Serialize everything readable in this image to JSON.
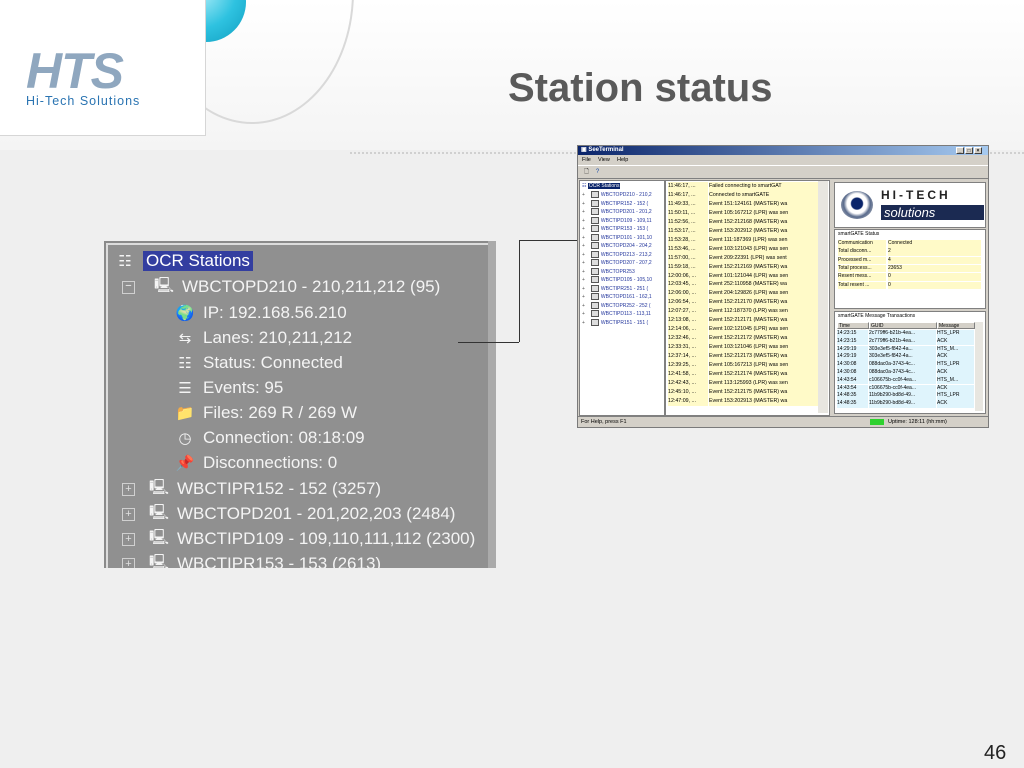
{
  "slide": {
    "title": "Station status",
    "number": "46"
  },
  "logo": {
    "mark": "HTS",
    "subtitle": "Hi-Tech Solutions"
  },
  "zoom_tree": {
    "root": "OCR Stations",
    "expanded_station": "WBCTOPD210 - 210,211,212  (95)",
    "details": [
      {
        "icon": "globe-icon",
        "text": "IP: 192.168.56.210"
      },
      {
        "icon": "lanes-icon",
        "text": "Lanes: 210,211,212"
      },
      {
        "icon": "network-status-icon",
        "text": "Status: Connected"
      },
      {
        "icon": "events-icon",
        "text": "Events: 95"
      },
      {
        "icon": "folder-icon",
        "text": "Files: 269 R / 269 W"
      },
      {
        "icon": "clock-icon",
        "text": "Connection: 08:18:09"
      },
      {
        "icon": "pushpin-icon",
        "text": "Disconnections: 0"
      }
    ],
    "other_stations": [
      "WBCTIPR152 - 152  (3257)",
      "WBCTOPD201 - 201,202,203  (2484)",
      "WBCTIPD109 - 109,110,111,112  (2300)",
      "WBCTIPR153 - 153  (2613)"
    ]
  },
  "app": {
    "title": "SeeTerminal",
    "menu": [
      "File",
      "View",
      "Help"
    ],
    "tree_root": "OCR Stations",
    "tree_items": [
      "WBCTOPD210 - 210,2",
      "WBCTIPR152 - 152  (",
      "WBCTOPD201 - 201,2",
      "WBCTIPD109 - 109,11",
      "WBCTIPR153 - 153  (",
      "WBCTIPD101 - 101,10",
      "WBCTOPD204 - 204,2",
      "WBCTOPD213 - 213,2",
      "WBCTOPD207 - 207,2",
      "WBCTOPR253",
      "WBCTIPD105 - 105,10",
      "WBCTIPR251 - 251  (",
      "WBCTOPD161 - 162,1",
      "WBCTOPR252 - 252  (",
      "WBCTIPD113 - 113,11",
      "WBCTIPR151 - 151  ("
    ],
    "log": [
      [
        "11:46:17, ...",
        "Failed connecting to smartGAT"
      ],
      [
        "11:46:17, ...",
        "Connected to smartGATE"
      ],
      [
        "11:49:33, ...",
        "Event 151:124161 (MASTER) wa"
      ],
      [
        "11:50:11, ...",
        "Event 105:167212 (LPR) was sen"
      ],
      [
        "11:52:56, ...",
        "Event 152:212168 (MASTER) wa"
      ],
      [
        "11:53:17, ...",
        "Event 153:202912 (MASTER) wa"
      ],
      [
        "11:53:28, ...",
        "Event 111:187369 (LPR) was sen"
      ],
      [
        "11:53:46, ...",
        "Event 103:121043 (LPR) was sen"
      ],
      [
        "11:57:00, ...",
        "Event 209:22391 (LPR) was sent"
      ],
      [
        "11:59:18, ...",
        "Event 152:212169 (MASTER) wa"
      ],
      [
        "12:00:06, ...",
        "Event 101:121044 (LPR) was sen"
      ],
      [
        "12:03:45, ...",
        "Event 252:110958 (MASTER) wa"
      ],
      [
        "12:06:00, ...",
        "Event 204:129826 (LPR) was sen"
      ],
      [
        "12:06:54, ...",
        "Event 152:212170 (MASTER) wa"
      ],
      [
        "12:07:27, ...",
        "Event 112:187370 (LPR) was sen"
      ],
      [
        "12:13:08, ...",
        "Event 152:212171 (MASTER) wa"
      ],
      [
        "12:14:06, ...",
        "Event 102:121045 (LPR) was sen"
      ],
      [
        "12:32:46, ...",
        "Event 152:212172 (MASTER) wa"
      ],
      [
        "12:33:31, ...",
        "Event 103:121046 (LPR) was sen"
      ],
      [
        "12:37:14, ...",
        "Event 152:212173 (MASTER) wa"
      ],
      [
        "12:39:25, ...",
        "Event 105:167213 (LPR) was sen"
      ],
      [
        "12:41:58, ...",
        "Event 152:212174 (MASTER) wa"
      ],
      [
        "12:42:43, ...",
        "Event 113:125993 (LPR) was sen"
      ],
      [
        "12:45:10, ...",
        "Event 152:212175 (MASTER) wa"
      ],
      [
        "12:47:09, ...",
        "Event 153:202913 (MASTER) wa"
      ]
    ],
    "brand": {
      "line1": "HI-TECH",
      "line2": "solutions"
    },
    "status_title": "smartGATE Status",
    "status_rows": [
      [
        "Communication",
        "Connected"
      ],
      [
        "Total disconn...",
        "2"
      ],
      [
        "Processed m...",
        "4"
      ],
      [
        "Total process...",
        "23653"
      ],
      [
        "Resent mess...",
        "0"
      ],
      [
        "Total resent ...",
        "0"
      ]
    ],
    "trans_title": "smartGATE Message Transactions",
    "trans_headers": [
      "Time",
      "GUID",
      "Message"
    ],
    "trans_rows": [
      [
        "14:23:15",
        "2c779ff6-b21b-4ea...",
        "HTS_LPR"
      ],
      [
        "14:23:15",
        "2c779ff6-b21b-4ea...",
        "ACK"
      ],
      [
        "14:29:19",
        "303e3ef5-f842-4a...",
        "HTS_M..."
      ],
      [
        "14:29:19",
        "303e3ef5-f842-4a...",
        "ACK"
      ],
      [
        "14:30:08",
        "088dac0a-3743-4c...",
        "HTS_LPR"
      ],
      [
        "14:30:08",
        "088dac0a-3743-4c...",
        "ACK"
      ],
      [
        "14:43:54",
        "c106675b-cc0f-4ea...",
        "HTS_M..."
      ],
      [
        "14:43:54",
        "c106675b-cc0f-4ea...",
        "ACK"
      ],
      [
        "14:48:35",
        "11b9b290-bd8d-49...",
        "HTS_LPR"
      ],
      [
        "14:48:35",
        "11b9b290-bd8d-49...",
        "ACK"
      ]
    ],
    "status_bar": "For Help, press F1",
    "uptime": "Uptime: 128:11 (hh:mm)",
    "colors": {
      "title_bar": "#0a246a",
      "cell_bg": "#fffac8",
      "trans_bg": "#dff4fc",
      "uptime_led": "#2fd12f"
    }
  }
}
